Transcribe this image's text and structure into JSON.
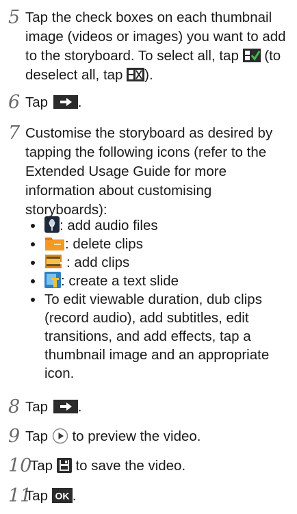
{
  "steps": [
    {
      "number": "5",
      "text_a": "Tap the check boxes on each thumbnail image (videos or images) you want to add to the storyboard. To select all, tap",
      "text_b": "(to deselect all, tap",
      "text_c": ").",
      "icons": [
        "select-all-icon",
        "deselect-all-icon"
      ]
    },
    {
      "number": "6",
      "text_a": "Tap",
      "text_b": ".",
      "icons": [
        "next-arrow-icon"
      ]
    },
    {
      "number": "7",
      "text": "Customise the storyboard as desired by tapping the following icons (refer to the Extended Usage Guide for more information about customising storyboards):",
      "bullets": [
        {
          "icon": "audio-icon",
          "text": ": add audio files"
        },
        {
          "icon": "delete-clips-icon",
          "text": ": delete clips"
        },
        {
          "icon": "add-clips-icon",
          "text": ": add clips"
        },
        {
          "icon": "text-slide-icon",
          "text": ": create a text slide"
        },
        {
          "text": "To edit viewable duration, dub clips (record audio), add subtitles, edit transitions, and add effects, tap a thumbnail image and an appropriate icon."
        }
      ]
    },
    {
      "number": "8",
      "text_a": "Tap",
      "text_b": ".",
      "icons": [
        "next-arrow-icon"
      ]
    },
    {
      "number": "9",
      "text_a": "Tap",
      "text_b": "to preview the video.",
      "icons": [
        "play-icon"
      ]
    },
    {
      "number": "10",
      "text_a": "Tap",
      "text_b": "to save the video.",
      "icons": [
        "save-icon"
      ]
    },
    {
      "number": "11",
      "text_a": "Tap",
      "text_b": ".",
      "icons": [
        "ok-icon"
      ]
    }
  ],
  "ok_label": "OK",
  "colors": {
    "step_number": "#6a6a6a",
    "text": "#1a1a1a",
    "icon_dark": "#2b2b2b",
    "icon_green": "#2f8a3a"
  }
}
